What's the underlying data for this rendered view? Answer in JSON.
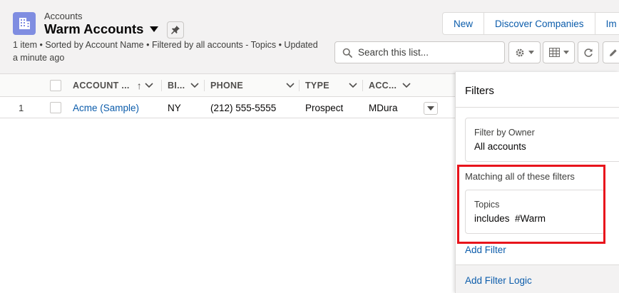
{
  "header": {
    "object_label": "Accounts",
    "list_title": "Warm Accounts",
    "meta_line1": "1 item • Sorted by Account Name • Filtered by all accounts - Topics • Updated",
    "meta_line2": "a minute ago",
    "buttons": [
      "New",
      "Discover Companies",
      "Im"
    ],
    "search_placeholder": "Search this list...",
    "icons": {
      "object": "accounts-building-icon",
      "title_dropdown": "caret-down-icon",
      "pin": "pin-icon",
      "search": "search-icon",
      "settings": "gear-icon",
      "display": "table-view-icon",
      "refresh": "refresh-icon",
      "edit": "pencil-icon"
    }
  },
  "table": {
    "columns": [
      "ACCOUNT ...",
      "BI...",
      "PHONE",
      "TYPE",
      "ACC..."
    ],
    "sort_indicator": "↑",
    "rows": [
      {
        "num": "1",
        "account_name": "Acme (Sample)",
        "billing": "NY",
        "phone": "(212) 555-5555",
        "type": "Prospect",
        "owner": "MDura"
      }
    ]
  },
  "filters": {
    "title": "Filters",
    "owner_label": "Filter by Owner",
    "owner_value": "All accounts",
    "matching_label": "Matching all of these filters",
    "topic_label": "Topics",
    "topic_value": "includes  #Warm",
    "add_filter": "Add Filter",
    "add_filter_logic": "Add Filter Logic"
  },
  "colors": {
    "header_bg": "#f3f2f2",
    "link": "#0b5cab",
    "object_icon": "#7f8de1",
    "highlight": "#e8141c"
  }
}
